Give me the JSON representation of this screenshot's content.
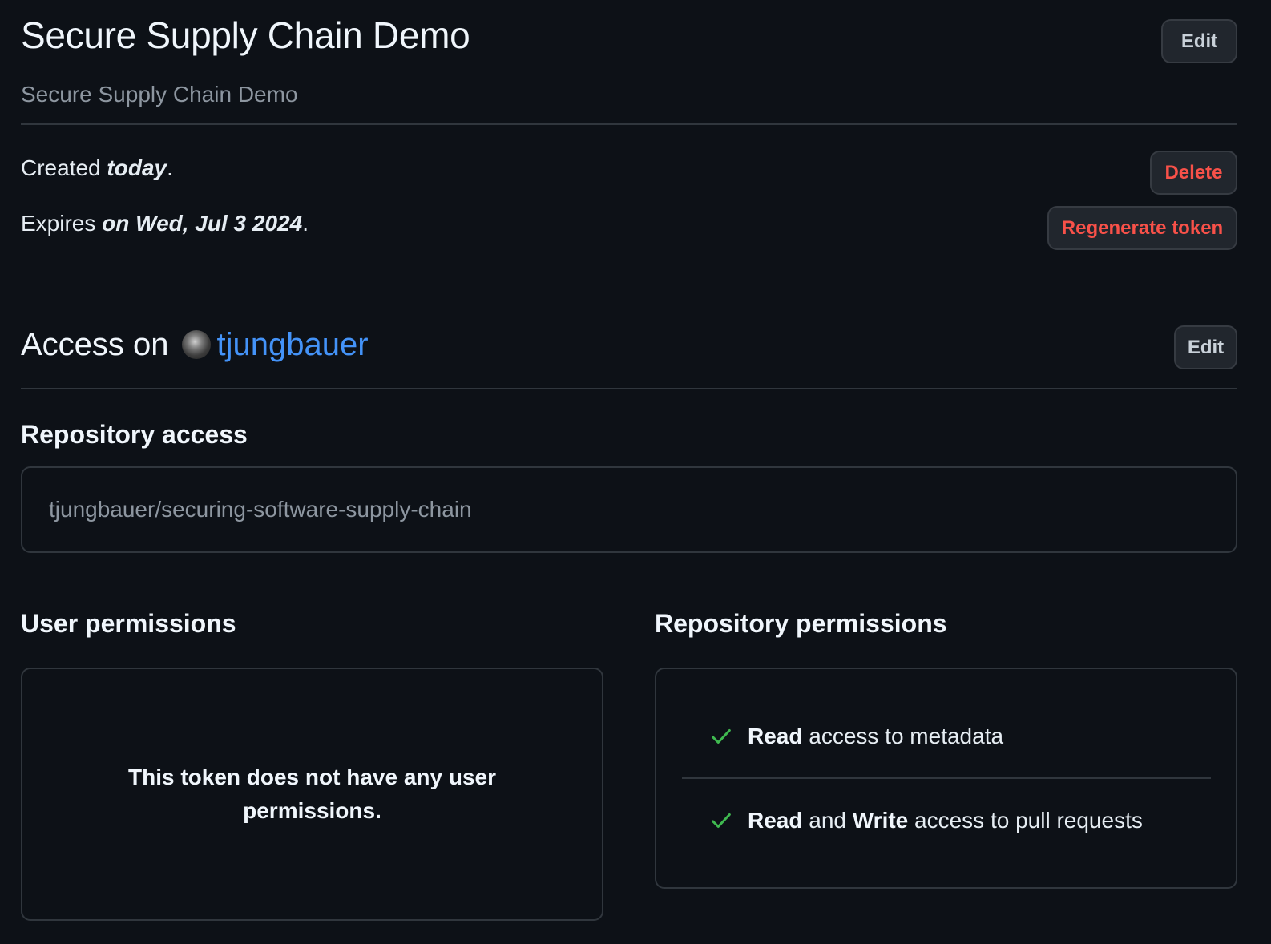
{
  "token": {
    "name": "Secure Supply Chain Demo",
    "description": "Secure Supply Chain Demo",
    "created_prefix": "Created ",
    "created_value": "today",
    "expires_prefix": "Expires ",
    "expires_value": "on Wed, Jul 3 2024",
    "period": "."
  },
  "buttons": {
    "edit": "Edit",
    "delete": "Delete",
    "regenerate": "Regenerate token",
    "access_edit": "Edit"
  },
  "access": {
    "prefix": "Access on",
    "owner": "tjungbauer"
  },
  "repository_access": {
    "heading": "Repository access",
    "repositories": [
      "tjungbauer/securing-software-supply-chain"
    ]
  },
  "user_permissions": {
    "heading": "User permissions",
    "empty_message": "This token does not have any user permissions."
  },
  "repository_permissions": {
    "heading": "Repository permissions",
    "items": [
      {
        "level_1": "Read",
        "joiner": "",
        "level_2": "",
        "rest": " access to metadata"
      },
      {
        "level_1": "Read",
        "joiner": " and ",
        "level_2": "Write",
        "rest": " access to pull requests"
      }
    ]
  },
  "colors": {
    "background": "#0d1117",
    "link": "#4493f8",
    "danger": "#f85149",
    "success": "#3fb950"
  }
}
